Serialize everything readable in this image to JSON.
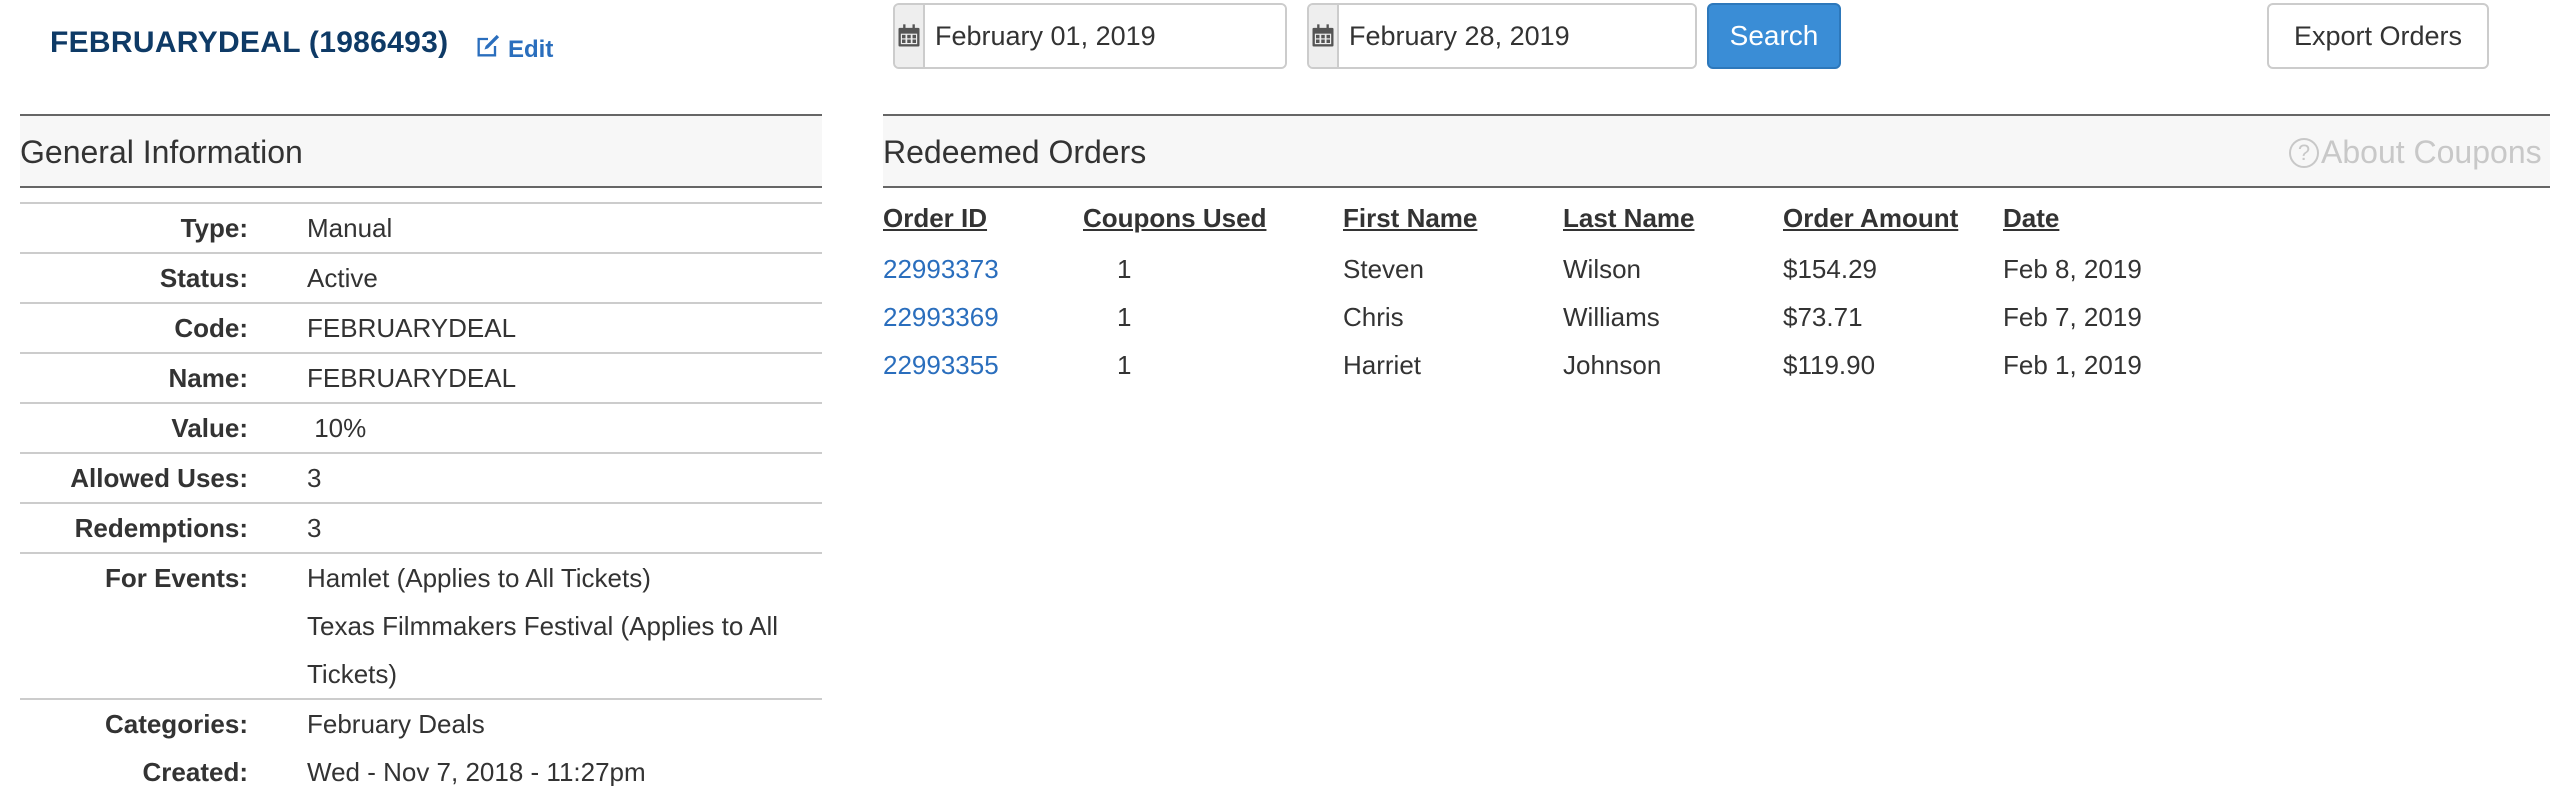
{
  "header": {
    "coupon_title": "FEBRUARYDEAL (1986493)",
    "edit_label": "Edit"
  },
  "filters": {
    "start_date": "February 01, 2019",
    "end_date": "February 28, 2019",
    "search_label": "Search",
    "export_label": "Export Orders"
  },
  "general_info": {
    "title": "General Information",
    "rows": [
      {
        "label": "Type:",
        "value": "Manual"
      },
      {
        "label": "Status:",
        "value": "Active"
      },
      {
        "label": "Code:",
        "value": "FEBRUARYDEAL"
      },
      {
        "label": "Name:",
        "value": "FEBRUARYDEAL"
      },
      {
        "label": "Value:",
        "value": " 10%"
      },
      {
        "label": "Allowed Uses:",
        "value": "3"
      },
      {
        "label": "Redemptions:",
        "value": "3"
      },
      {
        "label": "For Events:",
        "value": "Hamlet (Applies to All Tickets)"
      },
      {
        "label": "",
        "value": "Texas Filmmakers Festival (Applies to All"
      },
      {
        "label": "",
        "value": "Tickets)"
      },
      {
        "label": "Categories:",
        "value": "February Deals"
      },
      {
        "label": "Created:",
        "value": "Wed - Nov 7, 2018 - 11:27pm"
      }
    ]
  },
  "redeemed_orders": {
    "title": "Redeemed Orders",
    "about_label": "About Coupons",
    "columns": [
      "Order ID",
      "Coupons Used",
      "First Name",
      "Last Name",
      "Order Amount",
      "Date"
    ],
    "rows": [
      {
        "order_id": "22993373",
        "coupons_used": "1",
        "first_name": "Steven",
        "last_name": "Wilson",
        "amount": "$154.29",
        "date": "Feb 8, 2019"
      },
      {
        "order_id": "22993369",
        "coupons_used": "1",
        "first_name": "Chris",
        "last_name": "Williams",
        "amount": "$73.71",
        "date": "Feb 7, 2019"
      },
      {
        "order_id": "22993355",
        "coupons_used": "1",
        "first_name": "Harriet",
        "last_name": "Johnson",
        "amount": "$119.90",
        "date": "Feb 1, 2019"
      }
    ]
  },
  "icons": {
    "edit": "edit-icon",
    "calendar": "calendar-icon",
    "help": "question-circle-icon"
  },
  "colors": {
    "title": "#0e3a66",
    "link": "#2a6ebd",
    "primary_button": "#3a8dd6",
    "muted": "#c8c8c8"
  }
}
